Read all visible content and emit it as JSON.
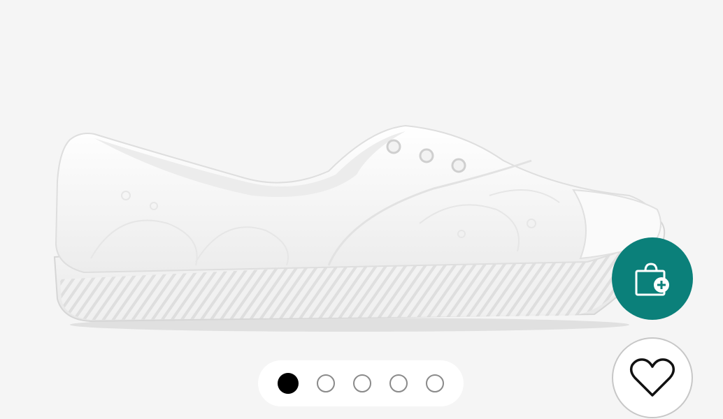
{
  "product": {
    "image_icon": "white-slip-on-sneaker-image"
  },
  "gallery": {
    "slide_count": 5,
    "active_index": 0
  },
  "actions": {
    "add_to_bag_icon": "shopping-bag-plus-icon",
    "favorite_icon": "heart-outline-icon"
  },
  "colors": {
    "background": "#f5f5f5",
    "accent": "#0b807a",
    "dot_active": "#000000",
    "dot_inactive_border": "#8a8a8a"
  }
}
